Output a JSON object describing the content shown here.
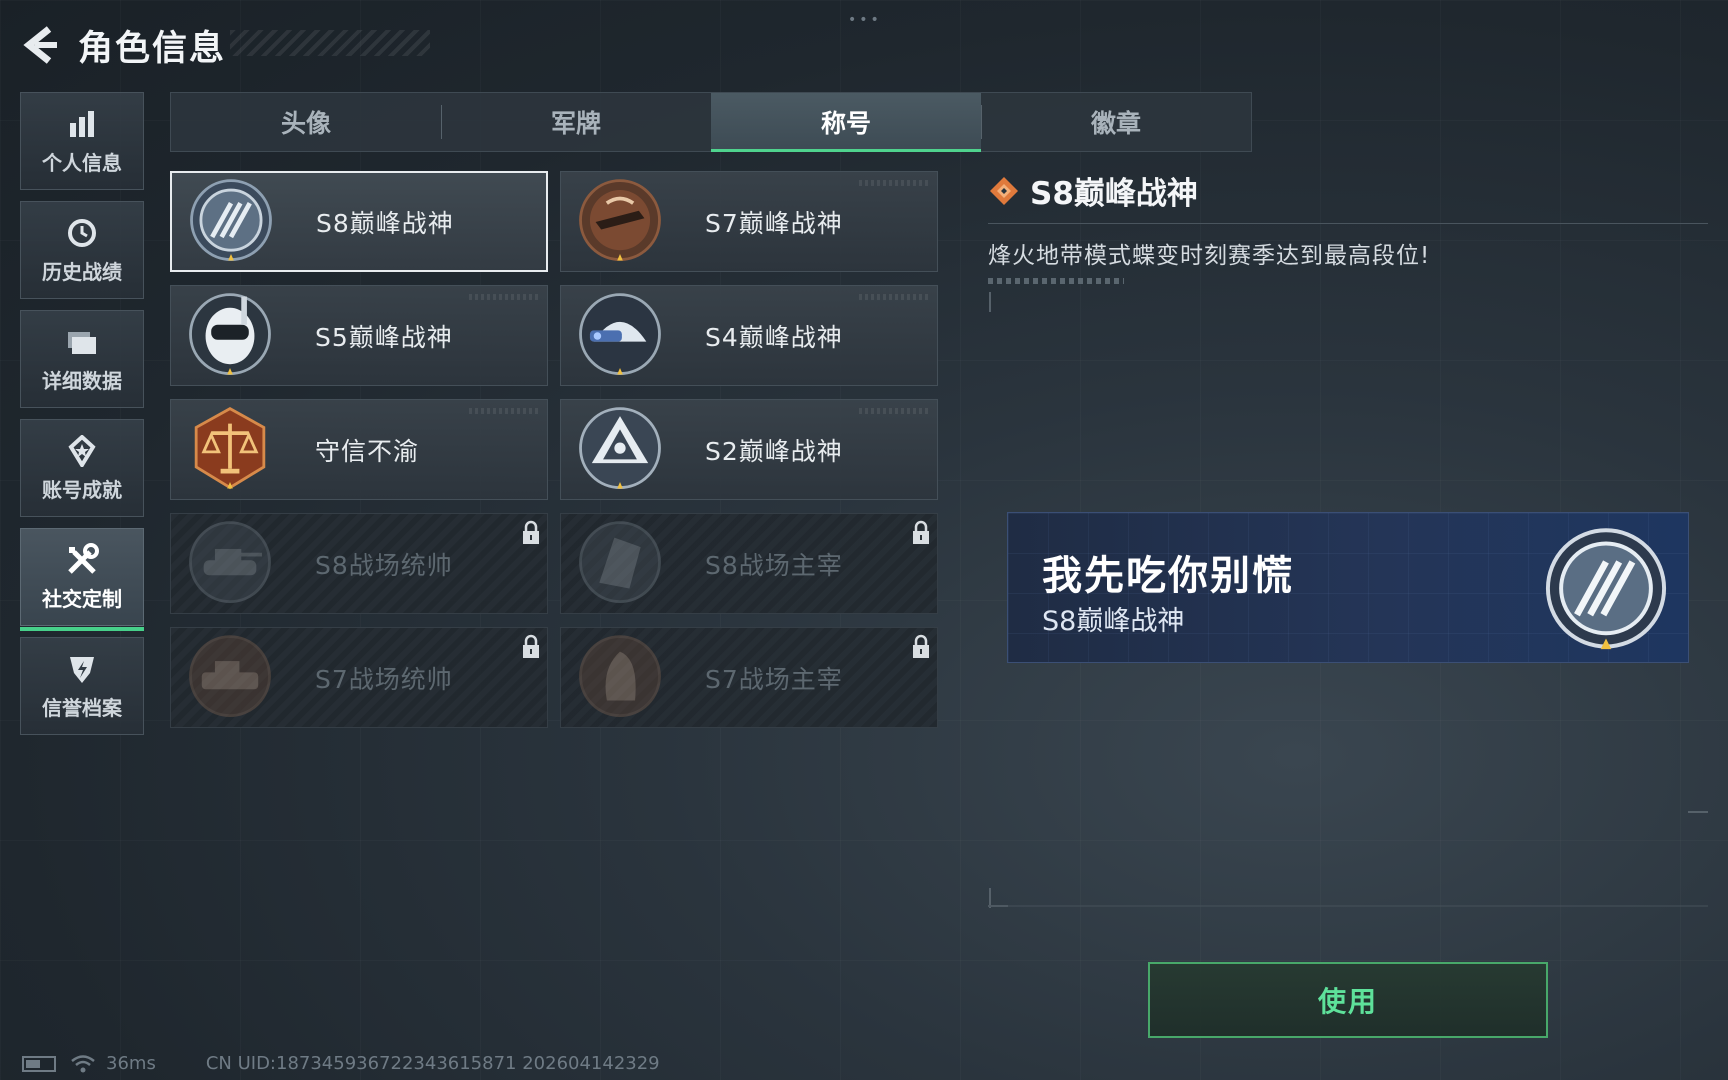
{
  "header": {
    "title": "角色信息"
  },
  "sidebar": {
    "items": [
      {
        "label": "个人信息",
        "icon": "bar-chart-icon"
      },
      {
        "label": "历史战绩",
        "icon": "history-clock-icon"
      },
      {
        "label": "详细数据",
        "icon": "folder-icon"
      },
      {
        "label": "账号成就",
        "icon": "medal-icon"
      },
      {
        "label": "社交定制",
        "icon": "tools-icon",
        "active": true
      },
      {
        "label": "信誉档案",
        "icon": "shield-icon"
      }
    ]
  },
  "tabs": [
    {
      "label": "头像"
    },
    {
      "label": "军牌"
    },
    {
      "label": "称号",
      "active": true
    },
    {
      "label": "徽章"
    }
  ],
  "titles": [
    {
      "name": "S8巅峰战神",
      "icon": "s8-peak-emblem-icon",
      "locked": false,
      "selected": true
    },
    {
      "name": "S7巅峰战神",
      "icon": "s7-peak-emblem-icon",
      "locked": false
    },
    {
      "name": "S5巅峰战神",
      "icon": "s5-peak-emblem-icon",
      "locked": false
    },
    {
      "name": "S4巅峰战神",
      "icon": "s4-peak-emblem-icon",
      "locked": false
    },
    {
      "name": "守信不渝",
      "icon": "scales-emblem-icon",
      "locked": false
    },
    {
      "name": "S2巅峰战神",
      "icon": "s2-peak-emblem-icon",
      "locked": false
    },
    {
      "name": "S8战场统帅",
      "icon": "tank-emblem-icon",
      "locked": true
    },
    {
      "name": "S8战场主宰",
      "icon": "building-emblem-icon",
      "locked": true
    },
    {
      "name": "S7战场统帅",
      "icon": "vehicle-emblem-icon",
      "locked": true
    },
    {
      "name": "S7战场主宰",
      "icon": "soldier-emblem-icon",
      "locked": true
    }
  ],
  "detail": {
    "title": "S8巅峰战神",
    "description": "烽火地带模式蝶变时刻赛季达到最高段位!"
  },
  "preview": {
    "player_name": "我先吃你别慌",
    "title": "S8巅峰战神"
  },
  "actions": {
    "use_label": "使用"
  },
  "footer": {
    "ping": "36ms",
    "uid": "CN UID:18734593672234361587​1 202604142329"
  },
  "colors": {
    "accent": "#4fd38e",
    "button_text": "#5ee19a",
    "preview_bg": "#243557",
    "detail_icon": "#e07a3c"
  }
}
